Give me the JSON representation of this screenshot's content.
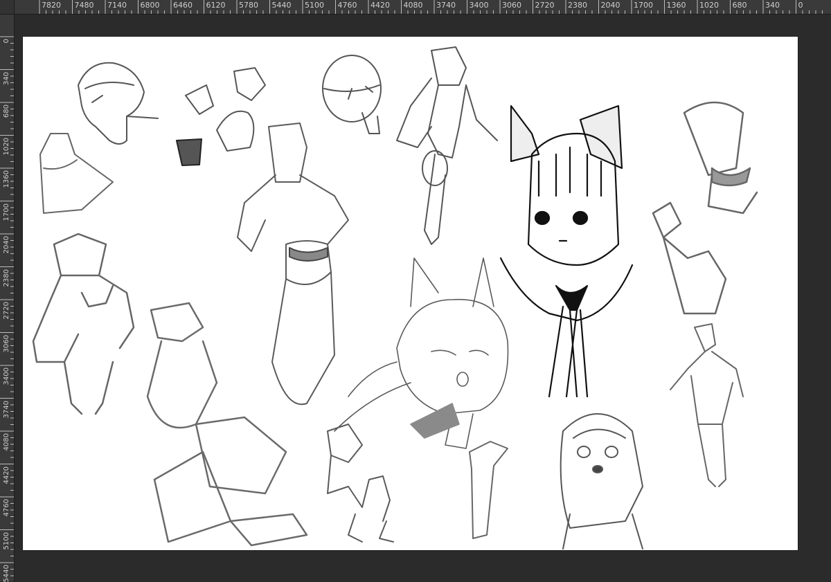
{
  "ruler": {
    "horizontal_labels": [
      "7820",
      "7480",
      "7140",
      "6800",
      "6460",
      "6120",
      "5780",
      "5440",
      "5100",
      "4760",
      "4420",
      "4080",
      "3740",
      "3400",
      "3060",
      "2720",
      "2380",
      "2040",
      "1700",
      "1360",
      "1020",
      "680",
      "340",
      "0"
    ],
    "vertical_labels": [
      "0",
      "340",
      "680",
      "1020",
      "1360",
      "1700",
      "2040",
      "2380",
      "2720",
      "3060",
      "3400",
      "3740",
      "4080",
      "4420",
      "4760",
      "5100",
      "5440"
    ]
  },
  "canvas": {
    "background": "#ffffff",
    "content": "sketch-sheet"
  },
  "colors": {
    "workspace": "#2b2b2b",
    "ruler": "#3a3a3a",
    "ruler_text": "#cfcfcf",
    "ink": "#111111",
    "pencil": "#6a6a6a",
    "shade": "#8a8a8a"
  }
}
